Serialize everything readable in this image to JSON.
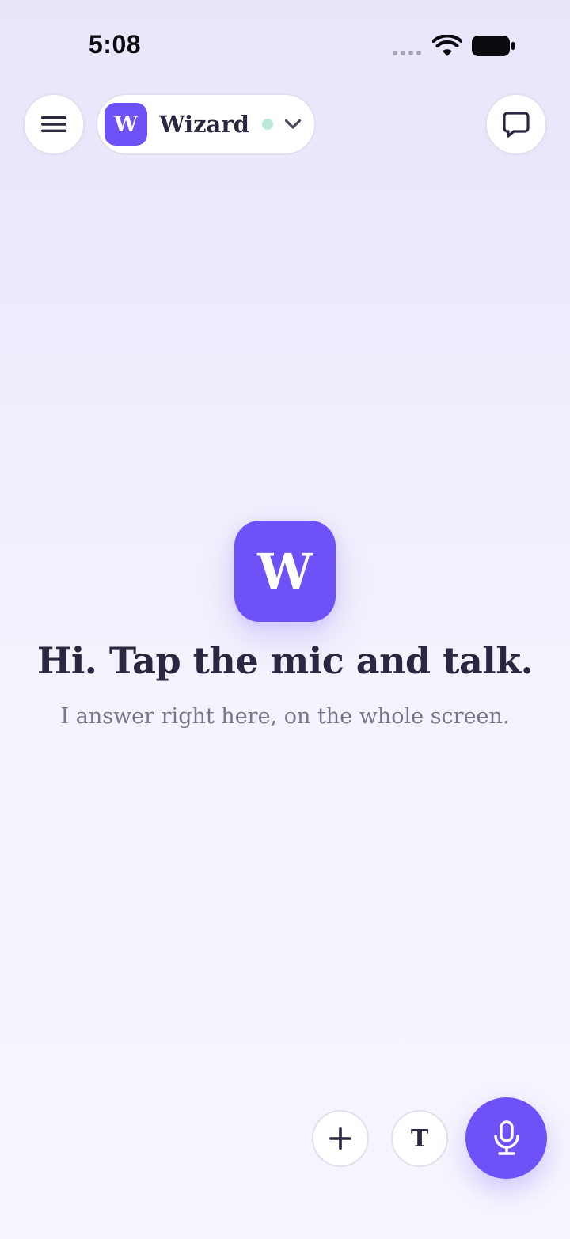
{
  "status_bar": {
    "time": "5:08"
  },
  "top_bar": {
    "assistant": {
      "logo_letter": "W",
      "name": "Wizard",
      "status": "online"
    }
  },
  "main": {
    "logo_letter": "W",
    "headline": "Hi. Tap the mic and talk.",
    "subline": "I answer right here, on the whole screen."
  },
  "bottom_bar": {
    "text_button_glyph": "T"
  },
  "colors": {
    "accent": "#6e52f7",
    "text_primary": "#2c2640",
    "text_secondary": "#7a7488",
    "status_online": "#bce8d8"
  },
  "icons": {
    "menu": "hamburger-menu-icon",
    "chat": "chat-bubble-icon",
    "chevron": "chevron-down-icon",
    "plus": "plus-icon",
    "mic": "microphone-icon",
    "wifi": "wifi-icon",
    "battery": "battery-icon"
  }
}
